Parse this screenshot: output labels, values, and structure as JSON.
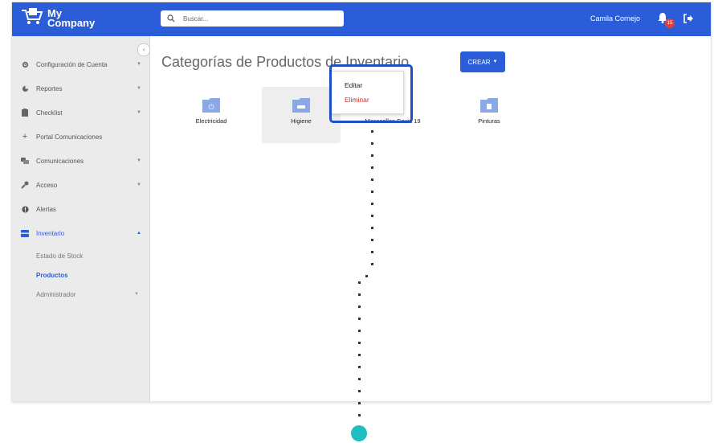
{
  "header": {
    "logo_line1": "My",
    "logo_line2": "Company",
    "search_placeholder": "Buscar...",
    "user_name": "Camila Cornejo",
    "notification_count": "15"
  },
  "sidebar": {
    "items": [
      {
        "label": "Configuración de Cuenta",
        "icon": "gear-icon"
      },
      {
        "label": "Reportes",
        "icon": "pie-chart-icon"
      },
      {
        "label": "Checklist",
        "icon": "clipboard-icon"
      },
      {
        "label": "Portal Comunicaciones",
        "icon": "plus-icon"
      },
      {
        "label": "Comunicaciones",
        "icon": "chat-icon"
      },
      {
        "label": "Acceso",
        "icon": "key-icon"
      },
      {
        "label": "Alertas",
        "icon": "alert-icon"
      },
      {
        "label": "Inventario",
        "icon": "box-icon"
      }
    ],
    "subitems": [
      {
        "label": "Estado de Stock"
      },
      {
        "label": "Productos"
      },
      {
        "label": "Administrador"
      }
    ]
  },
  "main": {
    "title": "Categorías de Productos de Inventario",
    "crear_label": "CREAR",
    "categories": [
      {
        "label": "Electricidad",
        "icon": "plug-icon"
      },
      {
        "label": "Higiene",
        "icon": "bath-icon"
      },
      {
        "label": "Mascarillas Covid 19",
        "icon": "mask-icon"
      },
      {
        "label": "Pinturas",
        "icon": "paint-icon"
      }
    ]
  },
  "context_menu": {
    "edit_label": "Editar",
    "delete_label": "Eliminar"
  },
  "colors": {
    "primary": "#2b5dd8",
    "danger": "#d0312d",
    "pointer": "#1dbfbf",
    "folder": "#8ba8e6"
  }
}
